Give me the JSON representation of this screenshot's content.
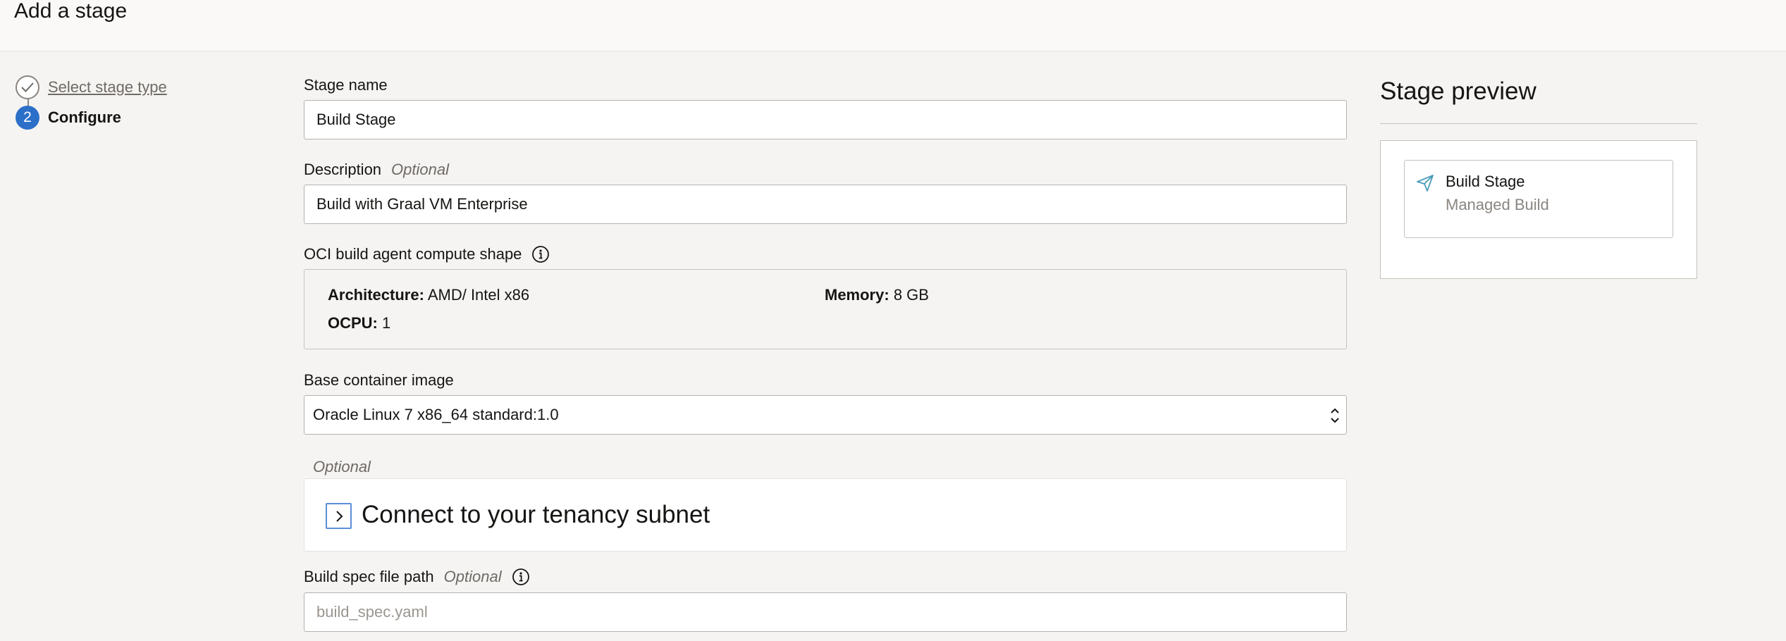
{
  "page": {
    "title": "Add a stage"
  },
  "stepper": {
    "steps": [
      {
        "number": "1",
        "label": "Select stage type",
        "state": "completed"
      },
      {
        "number": "2",
        "label": "Configure",
        "state": "current"
      }
    ]
  },
  "form": {
    "stage_name": {
      "label": "Stage name",
      "value": "Build Stage"
    },
    "description": {
      "label": "Description",
      "optional_label": "Optional",
      "value": "Build with Graal VM Enterprise"
    },
    "compute_shape": {
      "label": "OCI build agent compute shape",
      "architecture_label": "Architecture:",
      "architecture_value": "AMD/ Intel x86",
      "memory_label": "Memory:",
      "memory_value": "8 GB",
      "ocpu_label": "OCPU:",
      "ocpu_value": "1"
    },
    "base_image": {
      "label": "Base container image",
      "value": "Oracle Linux 7 x86_64 standard:1.0"
    },
    "tenancy_subnet": {
      "optional_label": "Optional",
      "title": "Connect to your tenancy subnet"
    },
    "build_spec": {
      "label": "Build spec file path",
      "optional_label": "Optional",
      "placeholder": "build_spec.yaml",
      "value": ""
    }
  },
  "preview": {
    "title": "Stage preview",
    "card_title": "Build Stage",
    "card_subtitle": "Managed Build",
    "card_icon": "send-icon"
  },
  "colors": {
    "accent": "#2b6fc9",
    "page_background": "#f5f4f2",
    "icon_teal": "#4a9bb8"
  }
}
